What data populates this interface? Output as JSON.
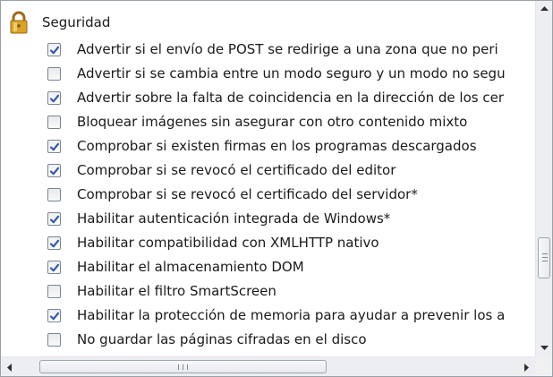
{
  "section": {
    "title": "Seguridad",
    "icon": "lock-icon"
  },
  "items": [
    {
      "label": "Advertir si el envío de POST se redirige a una zona que no peri",
      "checked": true
    },
    {
      "label": "Advertir si se cambia entre un modo seguro y un modo no segu",
      "checked": false
    },
    {
      "label": "Advertir sobre la falta de coincidencia en la dirección de los cer",
      "checked": true
    },
    {
      "label": "Bloquear imágenes sin asegurar con otro contenido mixto",
      "checked": false
    },
    {
      "label": "Comprobar si existen firmas en los programas descargados",
      "checked": true
    },
    {
      "label": "Comprobar si se revocó el certificado del editor",
      "checked": true
    },
    {
      "label": "Comprobar si se revocó el certificado del servidor*",
      "checked": false
    },
    {
      "label": "Habilitar autenticación integrada de Windows*",
      "checked": true
    },
    {
      "label": "Habilitar compatibilidad con XMLHTTP nativo",
      "checked": true
    },
    {
      "label": "Habilitar el almacenamiento DOM",
      "checked": true
    },
    {
      "label": "Habilitar el filtro SmartScreen",
      "checked": false
    },
    {
      "label": "Habilitar la protección de memoria para ayudar a prevenir los a",
      "checked": true
    },
    {
      "label": "No guardar las páginas cifradas en el disco",
      "checked": false
    }
  ],
  "scrollbars": {
    "vertical_position": 0.72,
    "horizontal_position": 0.0
  },
  "colors": {
    "checkmark": "#3158b0",
    "lock_body": "#d9a326",
    "lock_shackle": "#9c6d1a",
    "scrollbar_track": "#eceef1"
  }
}
